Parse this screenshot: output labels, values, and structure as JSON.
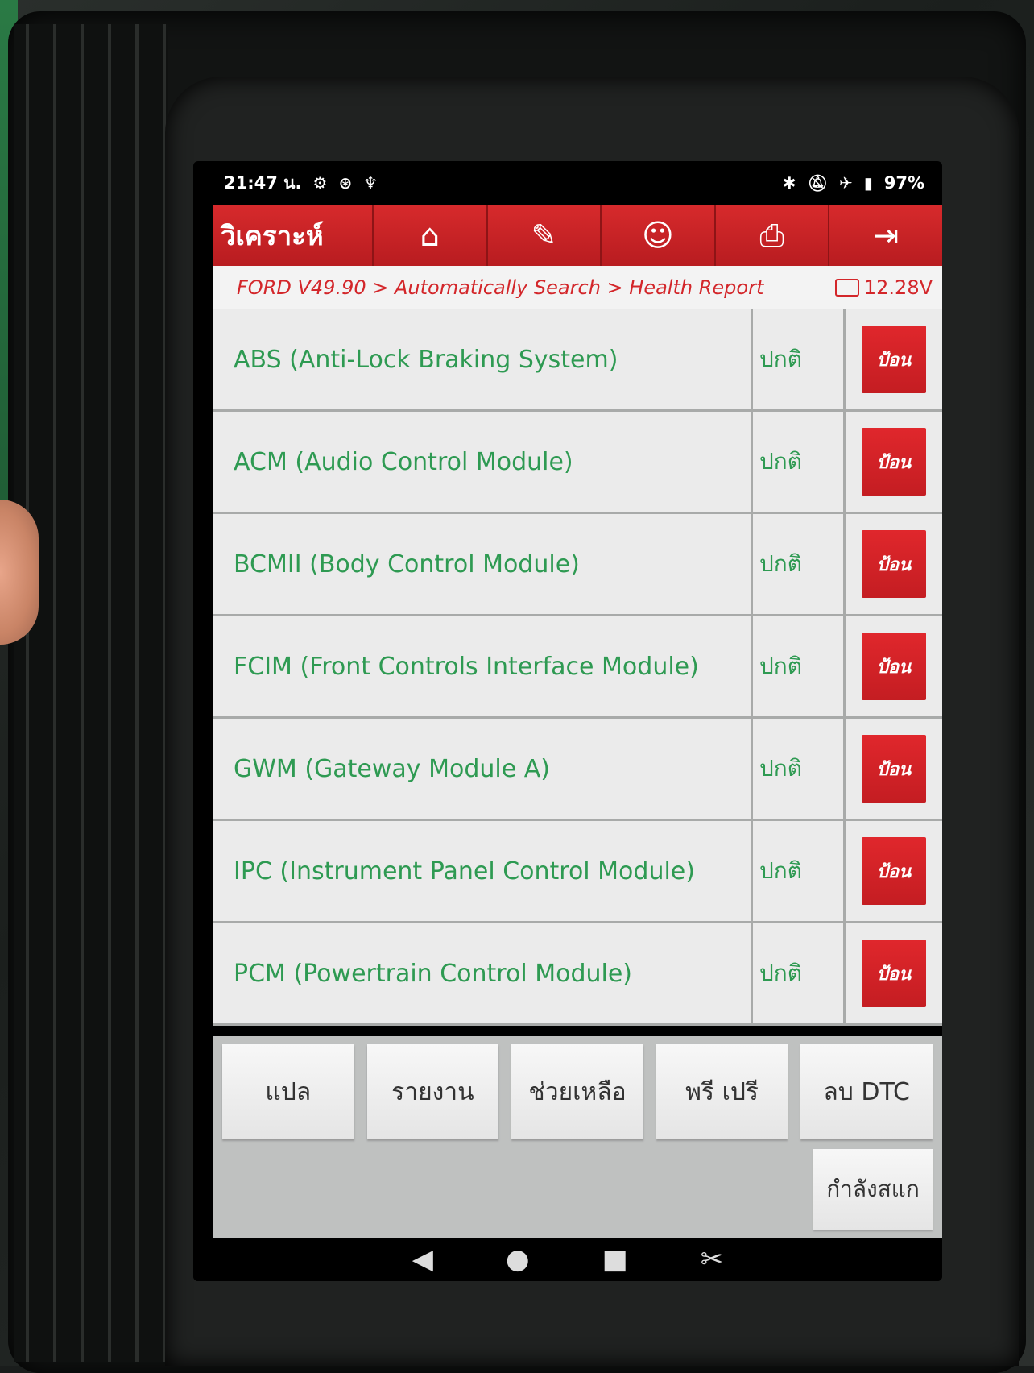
{
  "status_bar": {
    "time": "21:47 น.",
    "icons_left": [
      "gear-icon",
      "sync-icon",
      "stethoscope-icon"
    ],
    "icons_right": [
      "bluetooth-icon",
      "mute-icon",
      "airplane-icon",
      "battery-icon"
    ],
    "battery": "97%"
  },
  "appbar": {
    "title": "วิเคราะห์",
    "icons": [
      "home-icon",
      "edit-icon",
      "support-icon",
      "print-icon",
      "exit-icon"
    ]
  },
  "breadcrumb": {
    "path": "FORD V49.90 > Automatically Search > Health Report",
    "voltage": "12.28V"
  },
  "modules": [
    {
      "name": "ABS (Anti-Lock Braking System)",
      "status": "ปกติ",
      "action": "ป้อน"
    },
    {
      "name": "ACM (Audio Control Module)",
      "status": "ปกติ",
      "action": "ป้อน"
    },
    {
      "name": "BCMII (Body Control Module)",
      "status": "ปกติ",
      "action": "ป้อน"
    },
    {
      "name": "FCIM (Front Controls Interface Module)",
      "status": "ปกติ",
      "action": "ป้อน"
    },
    {
      "name": "GWM (Gateway Module A)",
      "status": "ปกติ",
      "action": "ป้อน"
    },
    {
      "name": "IPC (Instrument Panel Control Module)",
      "status": "ปกติ",
      "action": "ป้อน"
    },
    {
      "name": "PCM (Powertrain Control Module)",
      "status": "ปกติ",
      "action": "ป้อน"
    }
  ],
  "bottom_buttons": {
    "translate": "แปล",
    "report": "รายงาน",
    "help": "ช่วยเหลือ",
    "preview": "พรี เปรี",
    "clear_dtc": "ลบ DTC",
    "scanning": "กำลังสแก"
  },
  "colors": {
    "accent_red": "#d72a2c",
    "text_green": "#2e9a52"
  }
}
